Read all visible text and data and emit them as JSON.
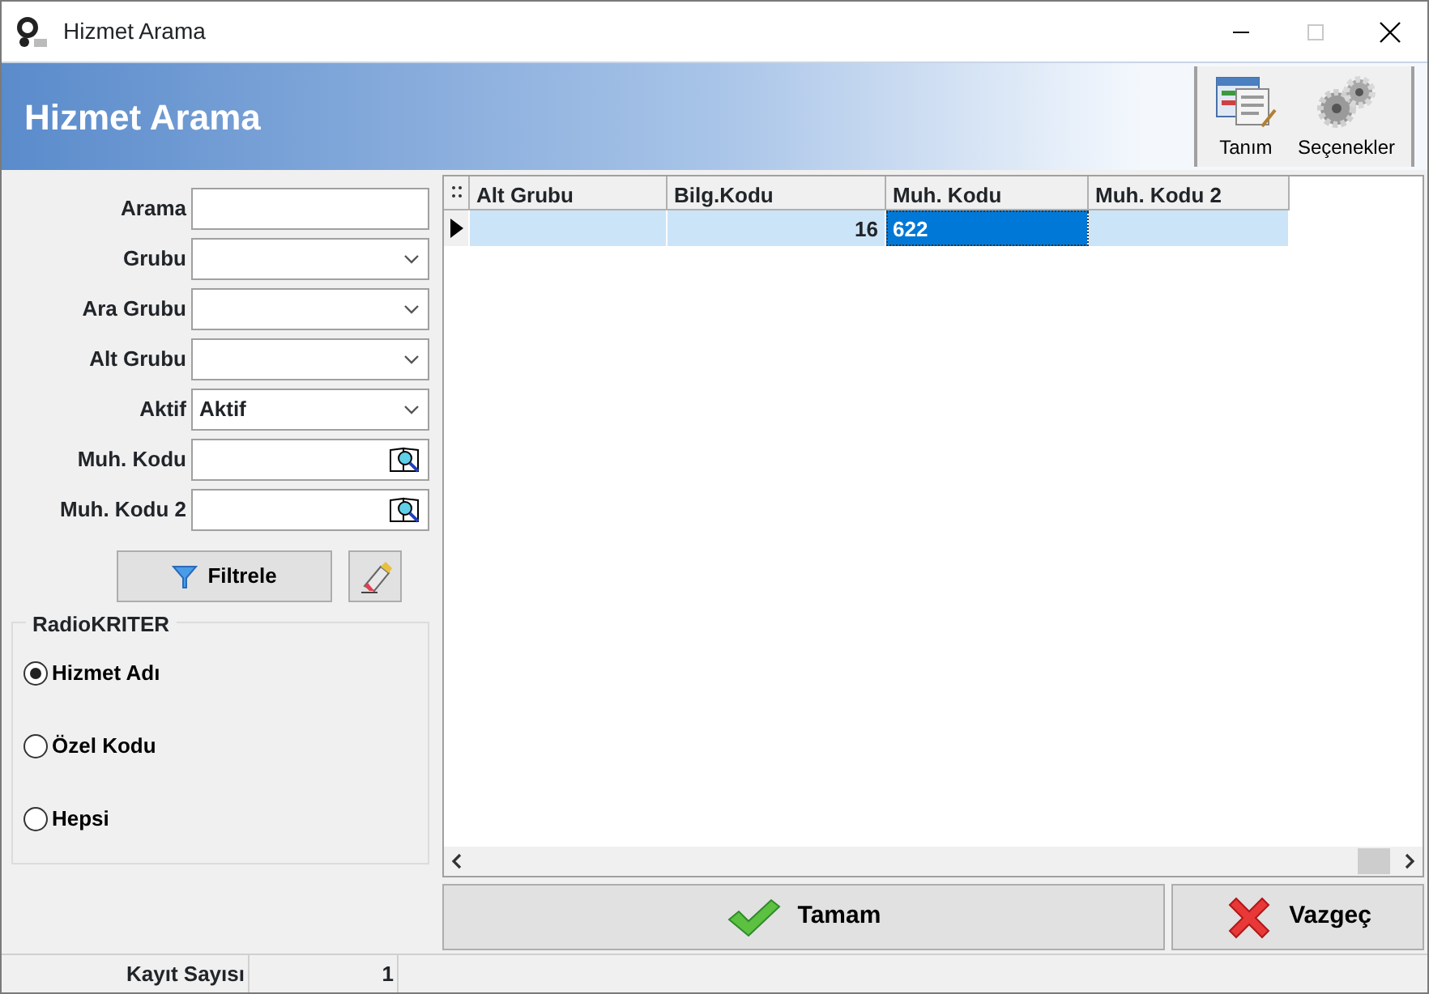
{
  "window": {
    "title": "Hizmet Arama"
  },
  "header": {
    "title": "Hizmet Arama",
    "tools": [
      {
        "label": "Tanım",
        "kind": "form"
      },
      {
        "label": "Seçenekler",
        "kind": "gears"
      }
    ]
  },
  "filters": [
    {
      "label": "Arama",
      "kind": "text"
    },
    {
      "label": "Grubu",
      "kind": "select"
    },
    {
      "label": "Ara Grubu",
      "kind": "select"
    },
    {
      "label": "Alt Grubu",
      "kind": "select"
    },
    {
      "label": "Aktif",
      "kind": "select",
      "value": "Aktif"
    },
    {
      "label": "Muh. Kodu",
      "kind": "lookup"
    },
    {
      "label": "Muh. Kodu 2",
      "kind": "lookup"
    }
  ],
  "filter_button": "Filtrele",
  "radio_group": {
    "title": "RadioKRITER",
    "options": [
      {
        "label": "Hizmet Adı",
        "selected": true
      },
      {
        "label": "Özel Kodu",
        "selected": false
      },
      {
        "label": "Hepsi",
        "selected": false
      }
    ]
  },
  "grid": {
    "columns": [
      "Alt Grubu",
      "Bilg.Kodu",
      "Muh. Kodu",
      "Muh. Kodu 2"
    ],
    "rows": [
      {
        "selected": true,
        "cells": [
          {
            "selected": false
          },
          {
            "text": "16",
            "selected": false
          },
          {
            "text": "622",
            "selected": true
          },
          {
            "selected": false
          }
        ]
      }
    ]
  },
  "buttons": [
    {
      "label": "Tamam",
      "kind": "ok"
    },
    {
      "label": "Vazgeç",
      "kind": "cancel"
    }
  ],
  "status_bar": {
    "label": "Kayıt Sayısı",
    "value": "1"
  }
}
